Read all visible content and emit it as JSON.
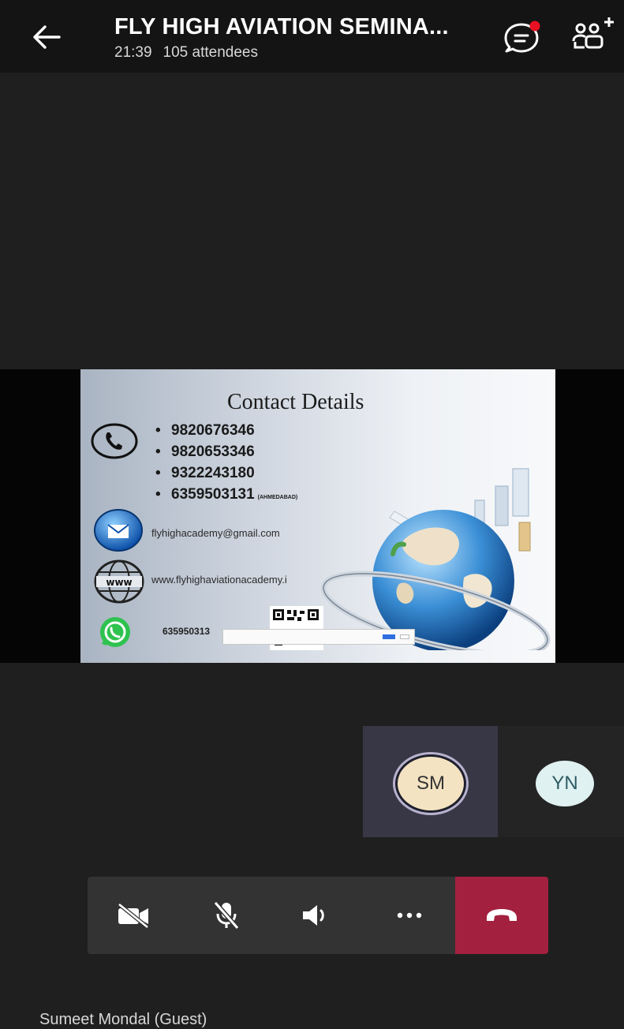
{
  "header": {
    "title": "FLY HIGH AVIATION SEMINA...",
    "time": "21:39",
    "attendees": "105 attendees",
    "back_icon": "back-arrow-icon",
    "chat_icon": "chat-icon",
    "chat_has_notification": true,
    "notification_color": "#e81123",
    "people_icon": "add-people-icon"
  },
  "shared_slide": {
    "title": "Contact Details",
    "phones": [
      {
        "number": "9820676346",
        "note": ""
      },
      {
        "number": "9820653346",
        "note": ""
      },
      {
        "number": "9322243180",
        "note": ""
      },
      {
        "number": "6359503131",
        "note": "(AHMEDABAD)"
      }
    ],
    "email": "flyhighacademy@gmail.com",
    "website": "www.flyhighaviationacademy.i",
    "whatsapp": "635950313",
    "icons": [
      "phone-icon",
      "email-icon",
      "www-icon",
      "whatsapp-icon",
      "qr-code-icon",
      "globe-illustration"
    ]
  },
  "participants": [
    {
      "initials": "SM",
      "active": true
    },
    {
      "initials": "YN",
      "active": false
    }
  ],
  "controls": {
    "buttons": [
      "camera-off-icon",
      "mic-off-icon",
      "speaker-icon",
      "more-icon",
      "hang-up-icon"
    ],
    "more_label": "···",
    "hangup_color": "#a3203f"
  },
  "footer": {
    "participant_name": "Sumeet Mondal (Guest)"
  }
}
